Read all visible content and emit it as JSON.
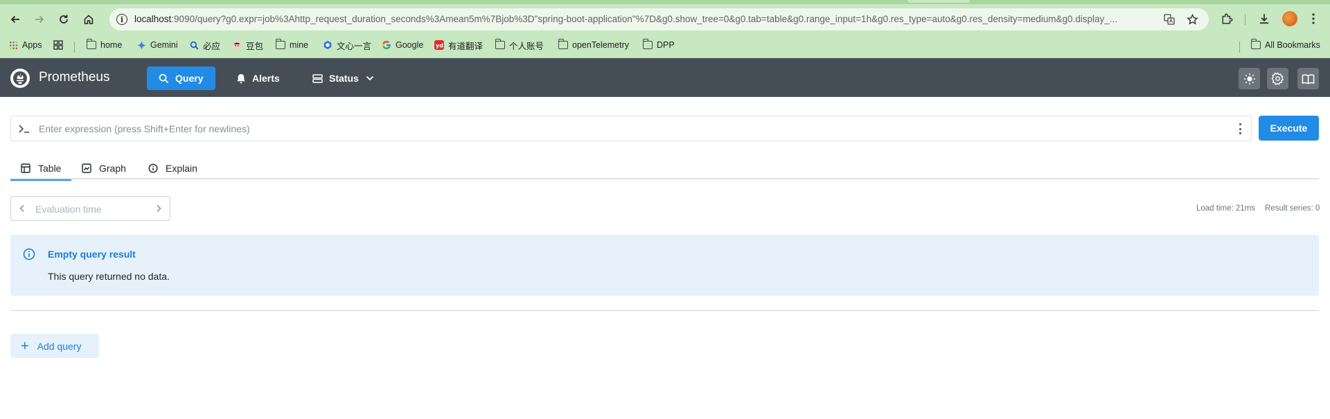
{
  "browser": {
    "url_host": "localhost",
    "url_rest": ":9090/query?g0.expr=job%3Ahttp_request_duration_seconds%3Amean5m%7Bjob%3D\"spring-boot-application\"%7D&g0.show_tree=0&g0.tab=table&g0.range_input=1h&g0.res_type=auto&g0.res_density=medium&g0.display_...",
    "bookmarks": [
      {
        "label": "Apps",
        "icon": "apps-grid-icon"
      },
      {
        "label": "",
        "icon": "tab-groups-icon"
      },
      {
        "label": "home",
        "icon": "folder-icon"
      },
      {
        "label": "Gemini",
        "icon": "gemini-icon"
      },
      {
        "label": "必应",
        "icon": "bing-icon"
      },
      {
        "label": "豆包",
        "icon": "doubao-icon"
      },
      {
        "label": "mine",
        "icon": "folder-icon"
      },
      {
        "label": "文心一言",
        "icon": "wenxin-icon"
      },
      {
        "label": "Google",
        "icon": "google-icon"
      },
      {
        "label": "有道翻译",
        "icon": "youdao-icon"
      },
      {
        "label": "个人账号",
        "icon": "folder-icon"
      },
      {
        "label": "openTelemetry",
        "icon": "folder-icon"
      },
      {
        "label": "DPP",
        "icon": "folder-icon"
      }
    ],
    "all_bookmarks": "All Bookmarks"
  },
  "header": {
    "brand": "Prometheus",
    "nav": {
      "query": "Query",
      "alerts": "Alerts",
      "status": "Status"
    }
  },
  "query": {
    "placeholder": "Enter expression (press Shift+Enter for newlines)",
    "execute_label": "Execute",
    "tabs": {
      "table": "Table",
      "graph": "Graph",
      "explain": "Explain"
    },
    "eval_placeholder": "Evaluation time",
    "load_time": "Load time: 21ms",
    "result_series": "Result series: 0",
    "alert_title": "Empty query result",
    "alert_message": "This query returned no data.",
    "add_query": "Add query"
  },
  "colors": {
    "accent": "#228be6",
    "header_bg": "#454e56",
    "alert_bg": "#e7f1fb"
  }
}
